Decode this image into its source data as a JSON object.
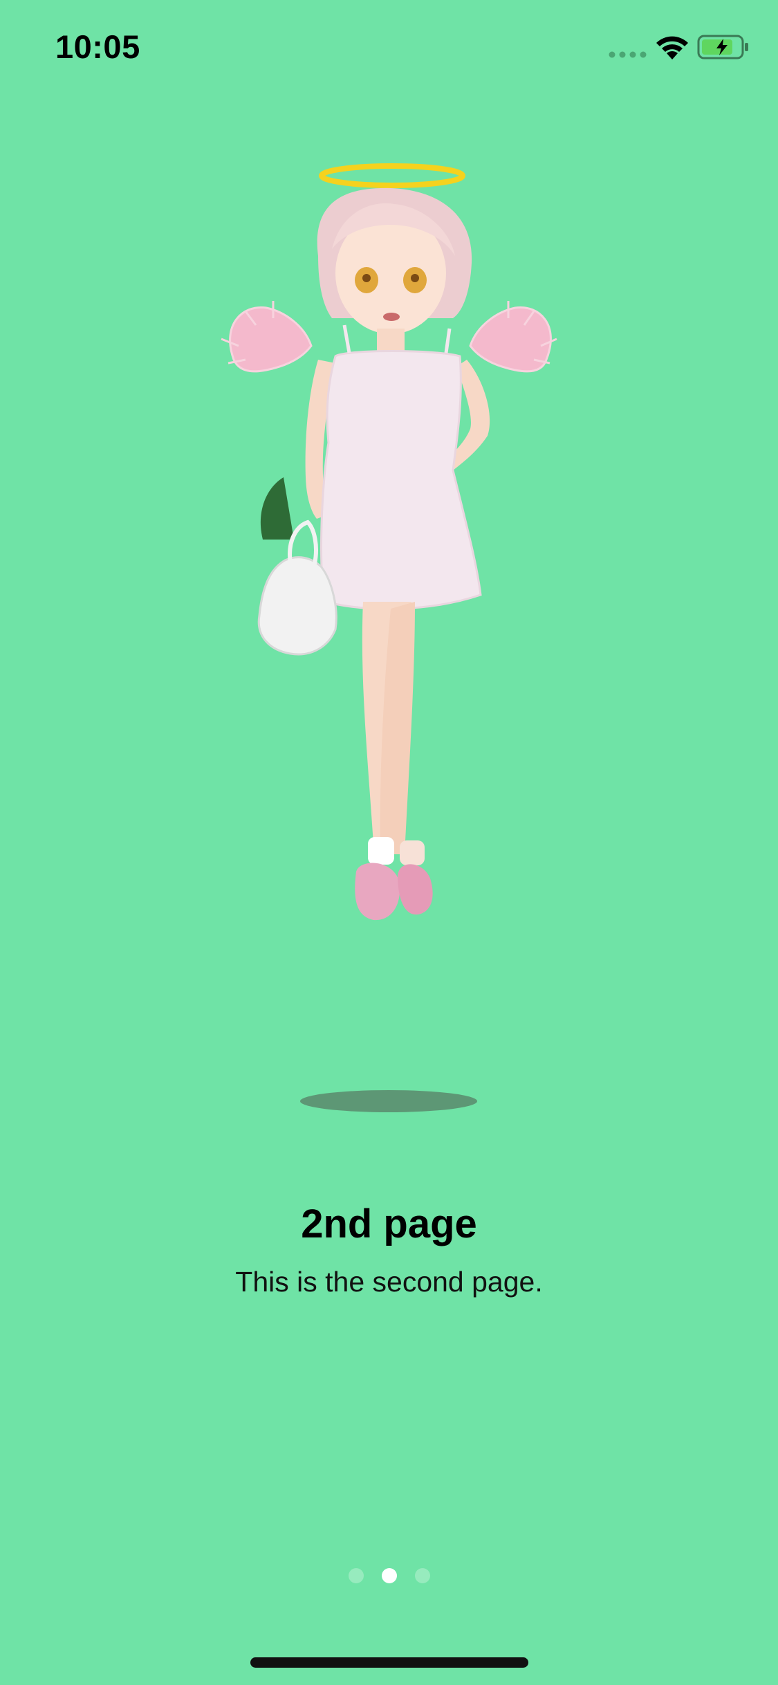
{
  "status_bar": {
    "time": "10:05",
    "icons": [
      "signal-icon",
      "wifi-icon",
      "battery-charging-icon"
    ]
  },
  "hero": {
    "description_icon": "angel-girl-illustration"
  },
  "content": {
    "title": "2nd page",
    "subtitle": "This is the second page."
  },
  "pager": {
    "page_count": 3,
    "current_index": 1
  },
  "colors": {
    "background": "#6fe3a6",
    "battery_fill": "#5fd65f",
    "halo": "#f5d21e"
  }
}
